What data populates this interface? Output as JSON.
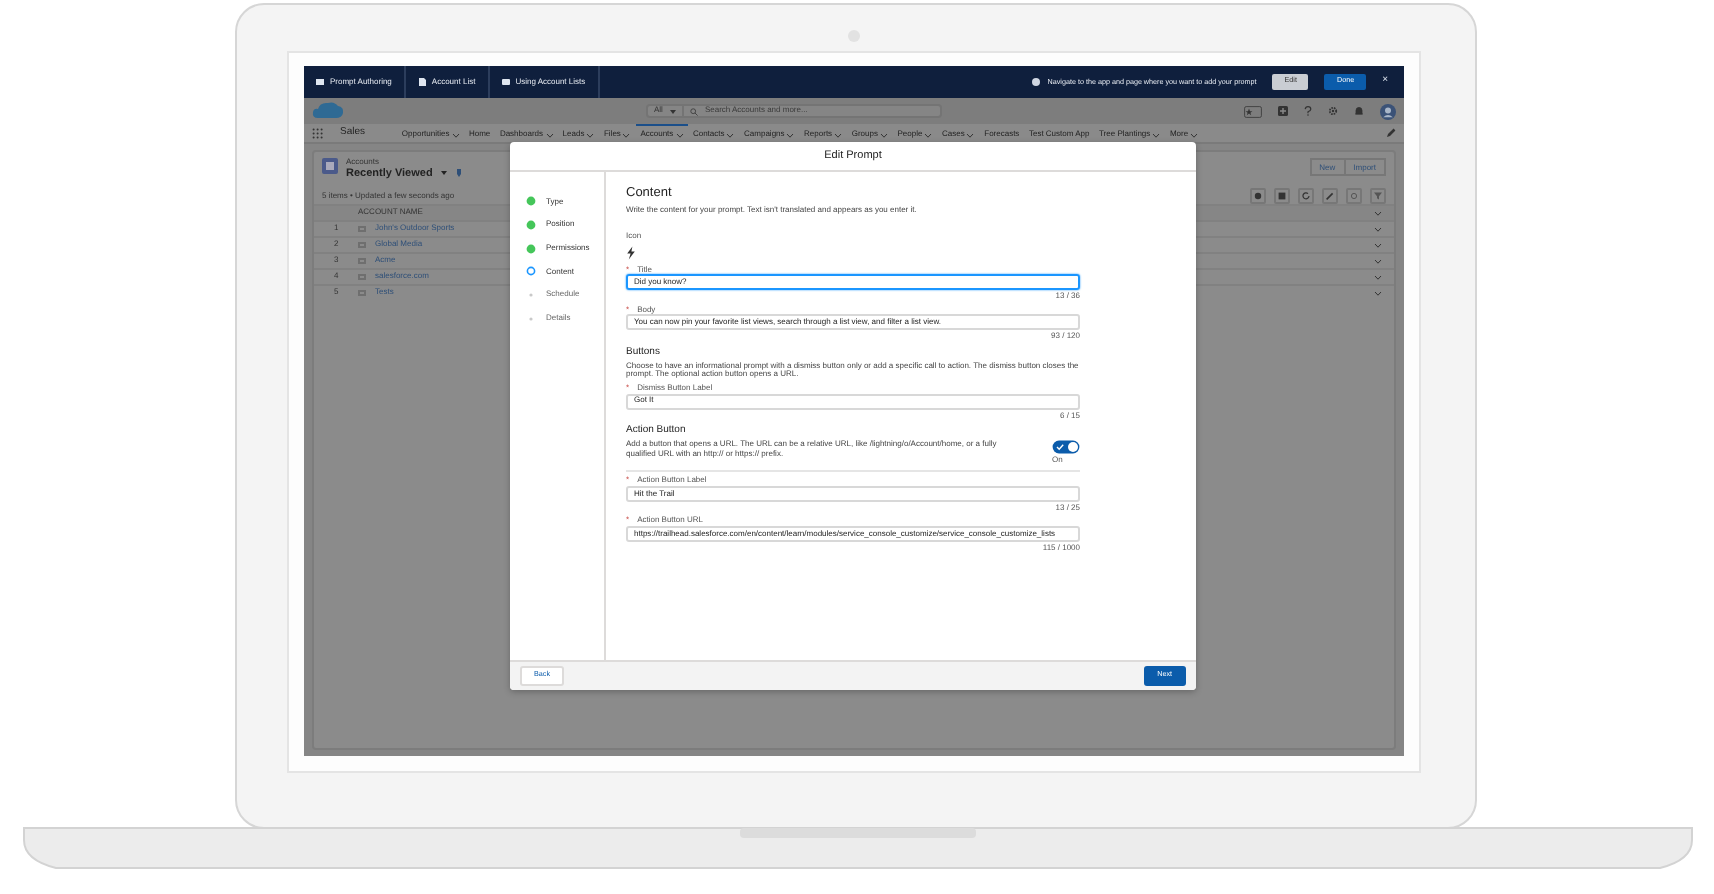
{
  "top_bar": {
    "tabs": [
      {
        "label": "Prompt Authoring"
      },
      {
        "label": "Account List"
      },
      {
        "label": "Using Account Lists"
      }
    ],
    "message": "Navigate to the app and page where you want to add your prompt",
    "edit_button": "Edit",
    "done_button": "Done",
    "close": "×"
  },
  "header": {
    "search_scope": "All",
    "search_placeholder": "Search Accounts and more..."
  },
  "nav": {
    "app_name": "Sales",
    "items": [
      {
        "label": "Opportunities",
        "dropdown": true,
        "selected": false
      },
      {
        "label": "Home",
        "dropdown": false,
        "selected": false
      },
      {
        "label": "Dashboards",
        "dropdown": true,
        "selected": false
      },
      {
        "label": "Leads",
        "dropdown": true,
        "selected": false
      },
      {
        "label": "Files",
        "dropdown": true,
        "selected": false
      },
      {
        "label": "Accounts",
        "dropdown": true,
        "selected": true
      },
      {
        "label": "Contacts",
        "dropdown": true,
        "selected": false
      },
      {
        "label": "Campaigns",
        "dropdown": true,
        "selected": false
      },
      {
        "label": "Reports",
        "dropdown": true,
        "selected": false
      },
      {
        "label": "Groups",
        "dropdown": true,
        "selected": false
      },
      {
        "label": "People",
        "dropdown": true,
        "selected": false
      },
      {
        "label": "Cases",
        "dropdown": true,
        "selected": false
      },
      {
        "label": "Forecasts",
        "dropdown": false,
        "selected": false
      },
      {
        "label": "Test Custom App",
        "dropdown": false,
        "selected": false
      },
      {
        "label": "Tree Plantings",
        "dropdown": true,
        "selected": false
      },
      {
        "label": "More",
        "dropdown": true,
        "selected": false
      }
    ]
  },
  "list_view": {
    "object": "Accounts",
    "title": "Recently Viewed",
    "status": "5 items • Updated a few seconds ago",
    "buttons": [
      "New",
      "Import"
    ],
    "column": "ACCOUNT NAME",
    "rows": [
      {
        "number": "1",
        "name": "John's Outdoor Sports",
        "checked": false
      },
      {
        "number": "2",
        "name": "Global Media",
        "checked": false
      },
      {
        "number": "3",
        "name": "Acme",
        "checked": false
      },
      {
        "number": "4",
        "name": "salesforce.com",
        "checked": false
      },
      {
        "number": "5",
        "name": "Tests",
        "checked": false
      }
    ]
  },
  "modal": {
    "title": "Edit Prompt",
    "steps": [
      {
        "label": "Type",
        "complete": true,
        "current": false
      },
      {
        "label": "Position",
        "complete": true,
        "current": false
      },
      {
        "label": "Permissions",
        "complete": true,
        "current": false
      },
      {
        "label": "Content",
        "complete": false,
        "current": true
      },
      {
        "label": "Schedule",
        "complete": false,
        "current": false
      },
      {
        "label": "Details",
        "complete": false,
        "current": false
      }
    ],
    "heading": "Content",
    "description": "Write the content for your prompt. Text isn't translated and appears as you enter it.",
    "icon_label": "Icon",
    "fields": [
      {
        "label": "Title",
        "required_mark": "*",
        "value": "Did you know?",
        "counter": "13 / 36",
        "focused": true
      },
      {
        "label": "Body",
        "required_mark": "*",
        "value": "You can now pin your favorite list views, search through a list view, and filter a list view.",
        "counter": "93 / 120",
        "focused": false
      }
    ],
    "sections": [
      {
        "heading": "Buttons",
        "description": "Choose to have an informational prompt with a dismiss button only or add a specific call to action. The dismiss button closes the prompt. The optional action button opens a URL.",
        "fields": [
          {
            "label": "Dismiss Button Label",
            "required_mark": "*",
            "value": "Got It",
            "counter": "6 / 15",
            "focused": false
          }
        ]
      },
      {
        "heading": "Action Button",
        "description": "Add a button that opens a URL. The URL can be a relative URL, like /lightning/o/Account/home, or a fully qualified URL with an http:// or https:// prefix.",
        "toggle": {
          "on": true,
          "label": "On"
        },
        "fields": [
          {
            "label": "Action Button Label",
            "required_mark": "*",
            "value": "Hit the Trail",
            "counter": "13 / 25",
            "focused": false
          },
          {
            "label": "Action Button URL",
            "required_mark": "*",
            "value": "https://trailhead.salesforce.com/en/content/learn/modules/service_console_customize/service_console_customize_lists",
            "counter": "115 / 1000",
            "focused": false
          }
        ]
      }
    ],
    "back_button": "Back",
    "next_button": "Next"
  }
}
